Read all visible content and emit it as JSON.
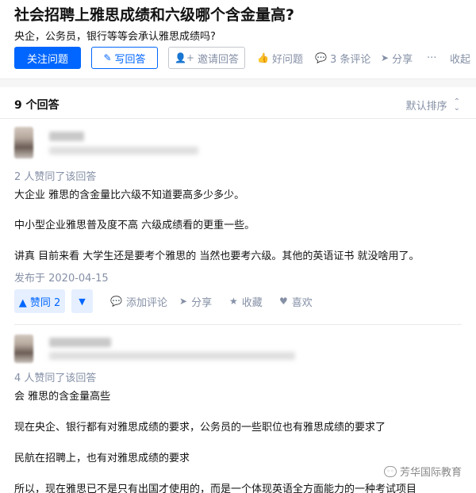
{
  "question": {
    "title": "社会招聘上雅思成绩和六级哪个含金量高?",
    "detail": "央企，公务员，银行等等会承认雅思成绩吗?",
    "actions": {
      "follow": "关注问题",
      "write": "写回答",
      "invite": "邀请回答",
      "good": "好问题",
      "comments": "3 条评论",
      "share": "分享",
      "more": "···",
      "collapse": "收起"
    }
  },
  "answers_header": {
    "count": "9 个回答",
    "sort": "默认排序"
  },
  "answers": [
    {
      "voters": "2 人赞同了该回答",
      "paragraphs": [
        "大企业 雅思的含金量比六级不知道要高多少多少。",
        "中小型企业雅思普及度不高 六级成绩看的更重一些。",
        "讲真 目前来看 大学生还是要考个雅思的 当然也要考六级。其他的英语证书 就没啥用了。"
      ],
      "published": "发布于 2020-04-15",
      "vote_up": "▲ 赞同 2",
      "vote_down": "▼",
      "actions": {
        "comment": "添加评论",
        "share": "分享",
        "favorite": "收藏",
        "like": "喜欢"
      }
    },
    {
      "voters": "4 人赞同了该回答",
      "paragraphs": [
        "会 雅思的含金量高些",
        "现在央企、银行都有对雅思成绩的要求，公务员的一些职位也有雅思成绩的要求了",
        "民航在招聘上，也有对雅思成绩的要求",
        "所以，现在雅思已不是只有出国才使用的，而是一个体现英语全方面能力的一种考试项目"
      ]
    }
  ],
  "watermark": "芳华国际教育",
  "icons": {
    "write": "pencil-icon",
    "invite": "add-user-icon",
    "good": "thumbs-up-icon",
    "comments": "comment-bubble-icon",
    "share": "paper-plane-icon",
    "sort": "chevron-up-down-icon",
    "favorite": "star-icon",
    "like": "heart-icon"
  },
  "colors": {
    "accent": "#0066ff",
    "accent_light": "#e5efff",
    "muted": "#8590a6"
  }
}
